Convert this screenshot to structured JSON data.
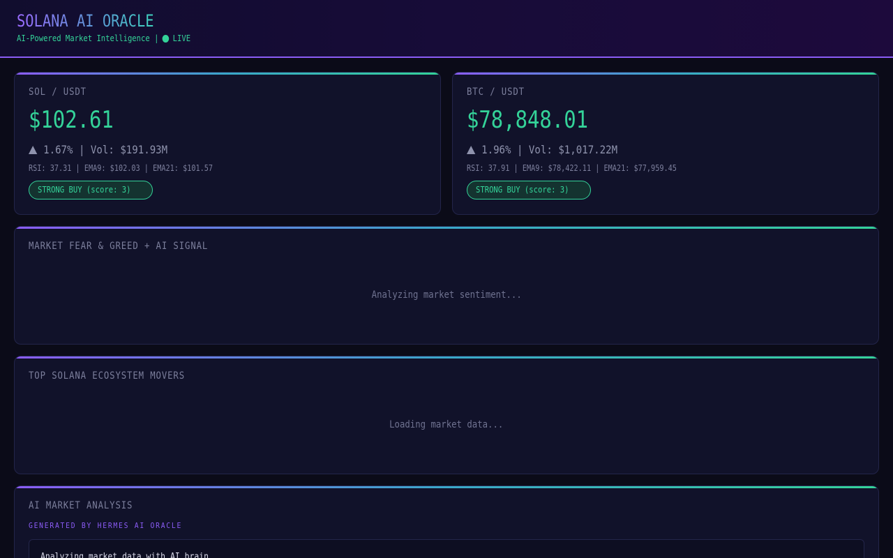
{
  "header": {
    "title": "SOLANA AI ORACLE",
    "subtitle": "AI-Powered Market Intelligence |",
    "live_label": "LIVE"
  },
  "tickers": [
    {
      "pair": "SOL / USDT",
      "price": "$102.61",
      "change": "1.67% | Vol: $191.93M",
      "indicators": "RSI: 37.31 | EMA9: $102.03 | EMA21: $101.57",
      "signal": "STRONG BUY (score: 3)"
    },
    {
      "pair": "BTC / USDT",
      "price": "$78,848.01",
      "change": "1.96% | Vol: $1,017.22M",
      "indicators": "RSI: 37.91 | EMA9: $78,422.11 | EMA21: $77,959.45",
      "signal": "STRONG BUY (score: 3)"
    }
  ],
  "sentiment": {
    "title": "MARKET FEAR & GREED + AI SIGNAL",
    "status": "Analyzing market sentiment..."
  },
  "movers": {
    "title": "TOP SOLANA ECOSYSTEM MOVERS",
    "status": "Loading market data..."
  },
  "analysis": {
    "title": "AI MARKET ANALYSIS",
    "generated_by": "GENERATED BY HERMES AI ORACLE",
    "text": "Analyzing market data with AI brain..."
  },
  "colors": {
    "accent_purple": "#8b5cf6",
    "accent_green": "#34d399",
    "background": "#0b0b18"
  }
}
